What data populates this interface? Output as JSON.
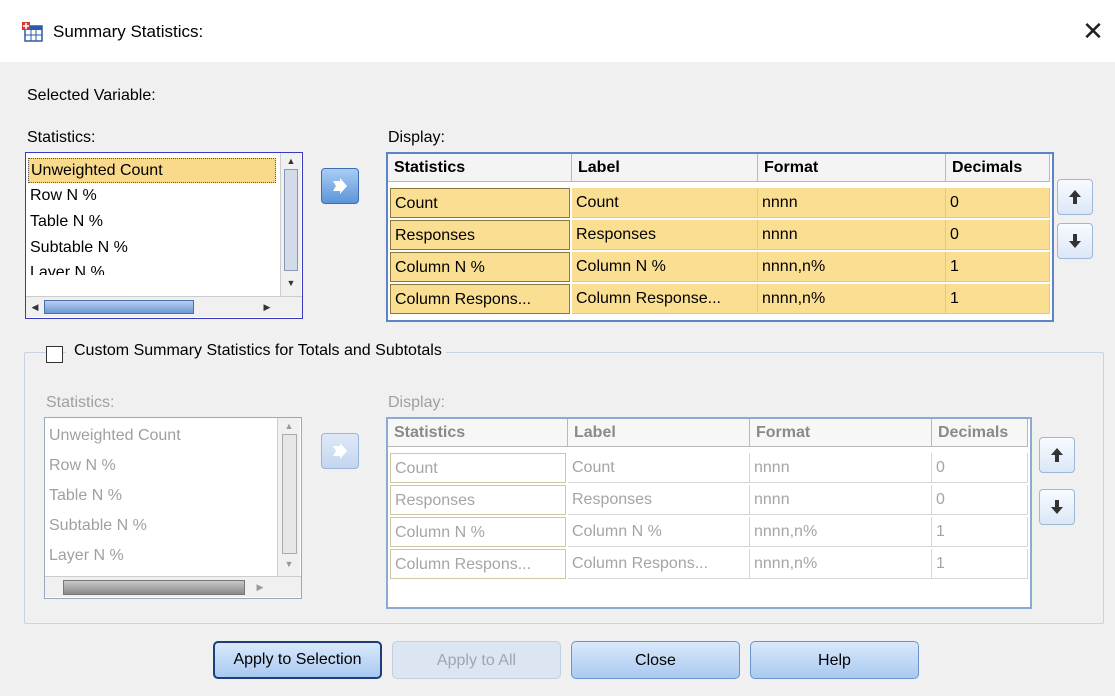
{
  "window": {
    "title": "Summary Statistics:",
    "close_glyph": "✕",
    "icon": "table-icon"
  },
  "selected_variable_label": "Selected Variable:",
  "top": {
    "statistics_label": "Statistics:",
    "statistics_items": [
      "Unweighted Count",
      "Row N %",
      "Table N %",
      "Subtable N %",
      "Layer N %"
    ],
    "selected_item": "Unweighted Count",
    "display_label": "Display:",
    "columns": [
      "Statistics",
      "Label",
      "Format",
      "Decimals"
    ],
    "rows": [
      [
        "Count",
        "Count",
        "nnnn",
        "0"
      ],
      [
        "Responses",
        "Responses",
        "nnnn",
        "0"
      ],
      [
        "Column N %",
        "Column N %",
        "nnnn,n%",
        "1"
      ],
      [
        "Column Respons...",
        "Column Response...",
        "nnnn,n%",
        "1"
      ]
    ]
  },
  "custom": {
    "checkbox_label": "Custom Summary Statistics for Totals and Subtotals",
    "checked": false,
    "statistics_label": "Statistics:",
    "statistics_items": [
      "Unweighted Count",
      "Row N %",
      "Table N %",
      "Subtable N %",
      "Layer N %"
    ],
    "display_label": "Display:",
    "columns": [
      "Statistics",
      "Label",
      "Format",
      "Decimals"
    ],
    "rows": [
      [
        "Count",
        "Count",
        "nnnn",
        "0"
      ],
      [
        "Responses",
        "Responses",
        "nnnn",
        "0"
      ],
      [
        "Column N %",
        "Column N %",
        "nnnn,n%",
        "1"
      ],
      [
        "Column Respons...",
        "Column Respons...",
        "nnnn,n%",
        "1"
      ]
    ]
  },
  "buttons": {
    "apply_selection": "Apply to Selection",
    "apply_all": "Apply to All",
    "close": "Close",
    "help": "Help"
  },
  "colors": {
    "selection": "#fadf93",
    "accent": "#5b85c7"
  }
}
